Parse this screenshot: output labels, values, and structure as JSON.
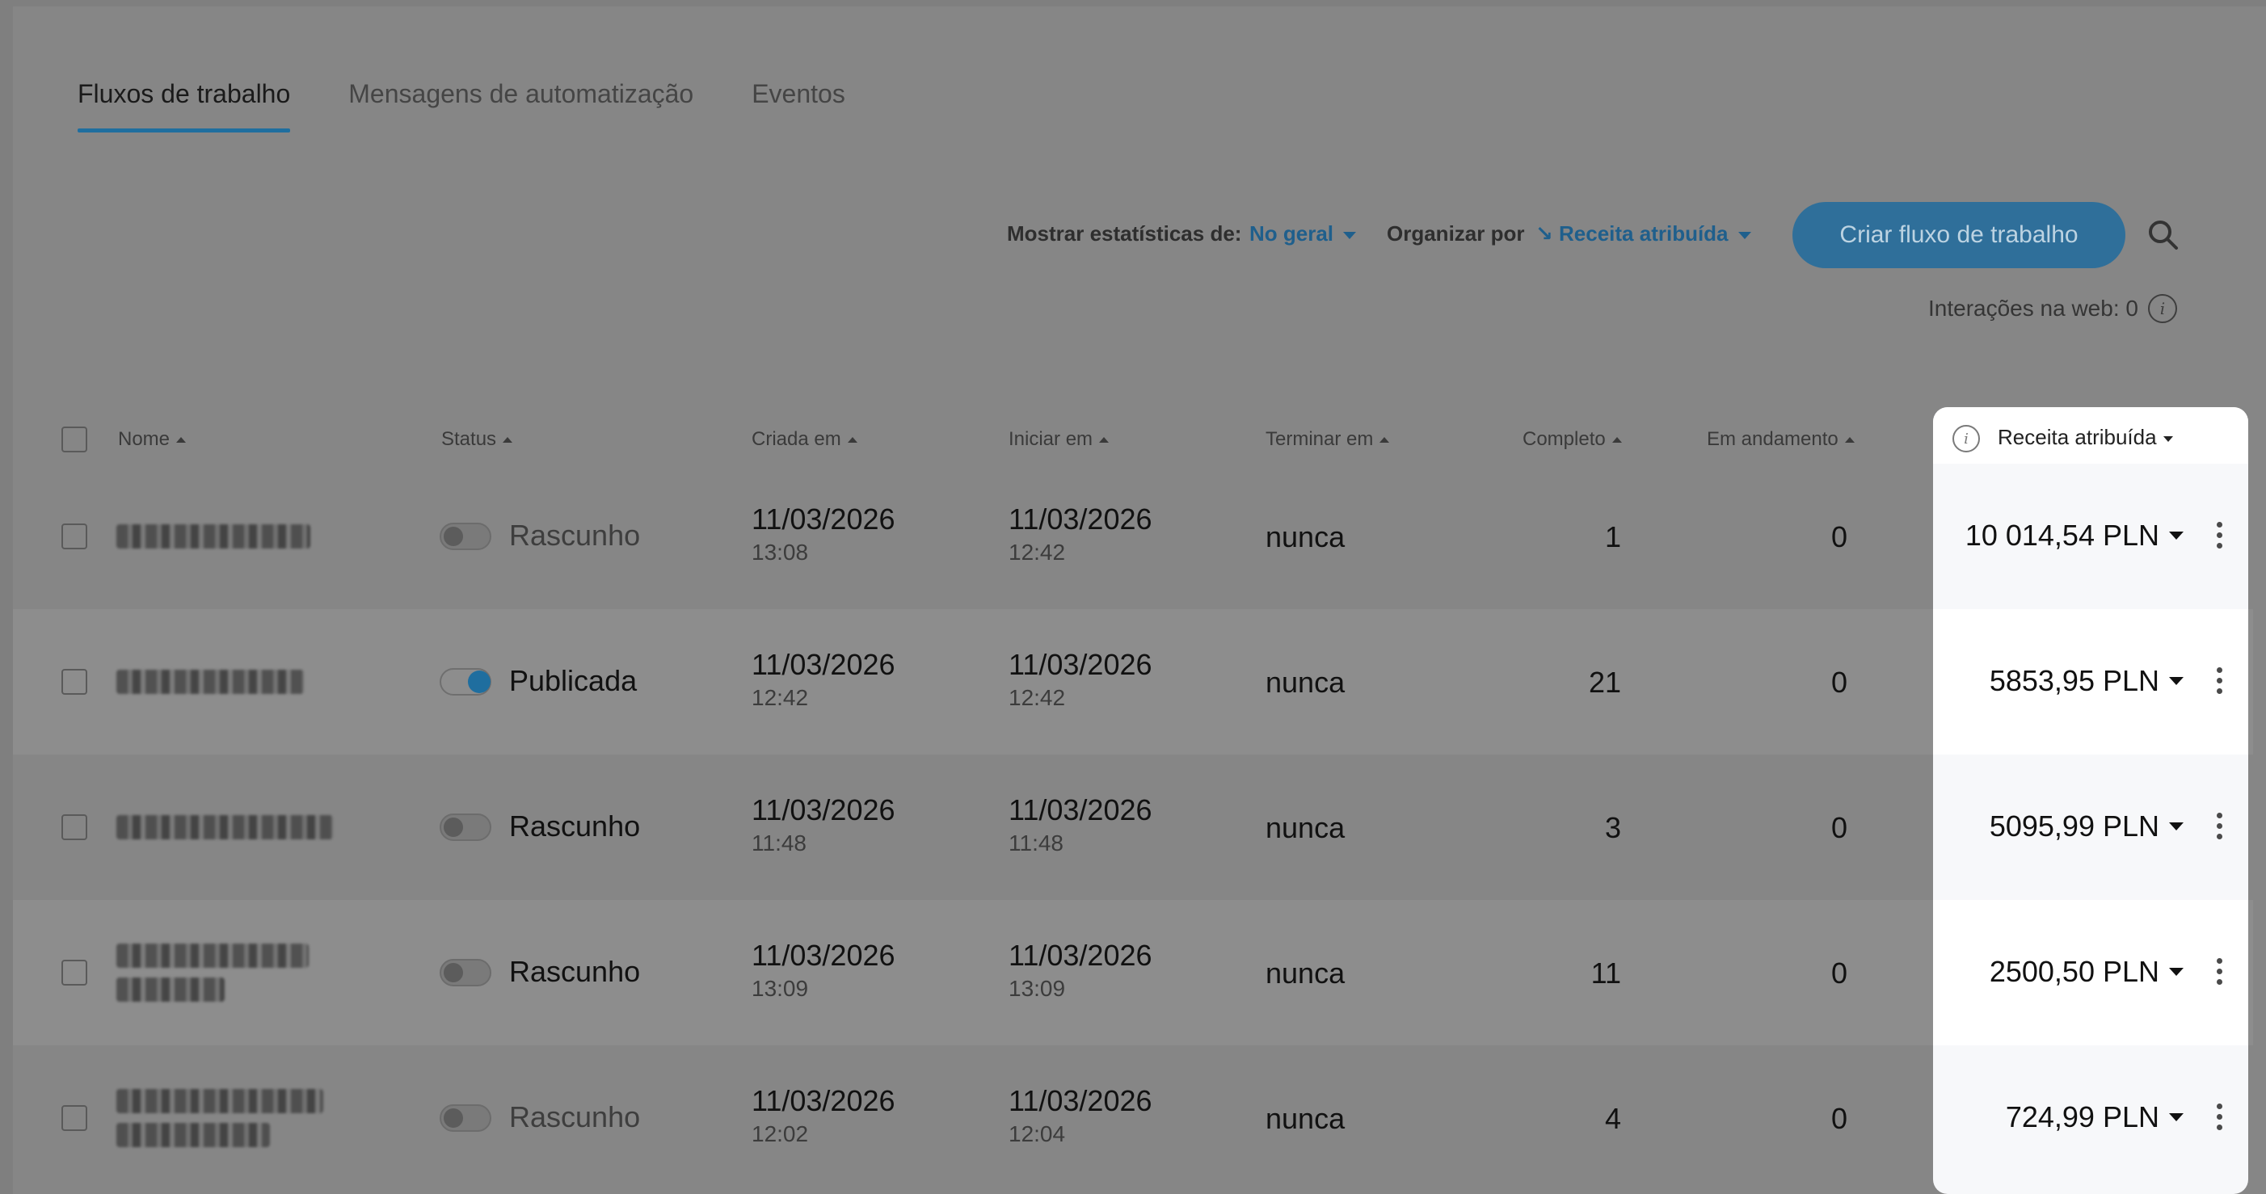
{
  "tabs": [
    {
      "label": "Fluxos de trabalho",
      "active": true
    },
    {
      "label": "Mensagens de automatização",
      "active": false
    },
    {
      "label": "Eventos",
      "active": false
    }
  ],
  "toolbar": {
    "stats_label": "Mostrar estatísticas de:",
    "stats_value": "No geral",
    "sort_label": "Organizar por",
    "sort_value": "↘ Receita atribuída",
    "create_button": "Criar fluxo de trabalho",
    "web_interactions": "Interações na web: 0",
    "info_glyph": "i"
  },
  "table": {
    "headers": {
      "name": "Nome",
      "status": "Status",
      "created": "Criada em",
      "start": "Iniciar em",
      "end": "Terminar em",
      "completed": "Completo",
      "in_progress": "Em andamento",
      "revenue": "Receita atribuída"
    },
    "rows": [
      {
        "status": "Rascunho",
        "published": false,
        "created_date": "11/03/2026",
        "created_time": "13:08",
        "start_date": "11/03/2026",
        "start_time": "12:42",
        "end": "nunca",
        "completed": "1",
        "in_progress": "0",
        "revenue": "10 014,54 PLN"
      },
      {
        "status": "Publicada",
        "published": true,
        "created_date": "11/03/2026",
        "created_time": "12:42",
        "start_date": "11/03/2026",
        "start_time": "12:42",
        "end": "nunca",
        "completed": "21",
        "in_progress": "0",
        "revenue": "5853,95 PLN"
      },
      {
        "status": "Rascunho",
        "published": false,
        "created_date": "11/03/2026",
        "created_time": "11:48",
        "start_date": "11/03/2026",
        "start_time": "11:48",
        "end": "nunca",
        "completed": "3",
        "in_progress": "0",
        "revenue": "5095,99 PLN"
      },
      {
        "status": "Rascunho",
        "published": false,
        "created_date": "11/03/2026",
        "created_time": "13:09",
        "start_date": "11/03/2026",
        "start_time": "13:09",
        "end": "nunca",
        "completed": "11",
        "in_progress": "0",
        "revenue": "2500,50 PLN"
      },
      {
        "status": "Rascunho",
        "published": false,
        "created_date": "11/03/2026",
        "created_time": "12:02",
        "start_date": "11/03/2026",
        "start_time": "12:04",
        "end": "nunca",
        "completed": "4",
        "in_progress": "0",
        "revenue": "724,99 PLN"
      }
    ]
  },
  "colors": {
    "accent": "#1f6e9f",
    "overlay": "#868686",
    "highlight_panel": "#ffffff"
  },
  "icons": [
    "search-icon",
    "info-icon",
    "kebab-menu-icon",
    "caret-down-icon",
    "sort-up-icon"
  ]
}
